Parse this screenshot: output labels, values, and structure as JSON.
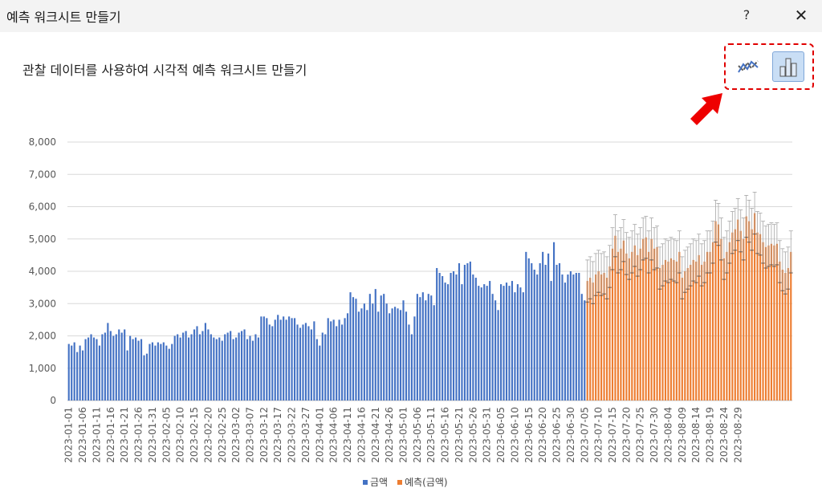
{
  "window": {
    "title": "예측 워크시트 만들기",
    "help_label": "?",
    "close_label": "✕"
  },
  "subtitle": "관찰 데이터를 사용하여 시각적 예측 워크시트 만들기",
  "chart_type_buttons": [
    {
      "name": "line-chart-icon",
      "selected": false
    },
    {
      "name": "column-chart-icon",
      "selected": true
    }
  ],
  "colors": {
    "actual": "#4472c4",
    "forecast": "#ed7d31",
    "gridline": "#d9d9d9",
    "error_bar": "#a6a6a6",
    "highlight": "#e00000"
  },
  "legend": {
    "actual_label": "금액",
    "forecast_label": "예측(금액)"
  },
  "chart_data": {
    "type": "bar",
    "ylim": [
      0,
      8000
    ],
    "y_ticks": [
      "0",
      "1,000",
      "2,000",
      "3,000",
      "4,000",
      "5,000",
      "6,000",
      "7,000",
      "8,000"
    ],
    "x_tick_labels": [
      "2023-01-01",
      "2023-01-06",
      "2023-01-11",
      "2023-01-16",
      "2023-01-21",
      "2023-01-26",
      "2023-01-31",
      "2023-02-05",
      "2023-02-10",
      "2023-02-15",
      "2023-02-20",
      "2023-02-25",
      "2023-03-02",
      "2023-03-07",
      "2023-03-12",
      "2023-03-17",
      "2023-03-22",
      "2023-03-27",
      "2023-04-01",
      "2023-04-06",
      "2023-04-11",
      "2023-04-16",
      "2023-04-21",
      "2023-04-26",
      "2023-05-01",
      "2023-05-06",
      "2023-05-11",
      "2023-05-16",
      "2023-05-21",
      "2023-05-26",
      "2023-05-31",
      "2023-06-05",
      "2023-06-10",
      "2023-06-15",
      "2023-06-20",
      "2023-06-25",
      "2023-06-30",
      "2023-07-05",
      "2023-07-10",
      "2023-07-15",
      "2023-07-20",
      "2023-07-25",
      "2023-07-30",
      "2023-08-04",
      "2023-08-09",
      "2023-08-14",
      "2023-08-19",
      "2023-08-24",
      "2023-08-29"
    ],
    "series": [
      {
        "name": "금액",
        "start": "2023-01-01",
        "values": [
          1750,
          1700,
          1800,
          1500,
          1700,
          1550,
          1900,
          1950,
          2050,
          1950,
          1900,
          1700,
          2050,
          2100,
          2400,
          2150,
          2000,
          2050,
          2200,
          2100,
          2200,
          1550,
          2000,
          1900,
          1950,
          1850,
          1900,
          1400,
          1450,
          1750,
          1800,
          1700,
          1800,
          1750,
          1800,
          1700,
          1600,
          1750,
          2000,
          2050,
          1950,
          2100,
          2150,
          1950,
          2050,
          2200,
          2300,
          2050,
          2150,
          2400,
          2200,
          2050,
          1950,
          1900,
          1950,
          1850,
          2050,
          2100,
          2150,
          1900,
          1950,
          2100,
          2150,
          2200,
          1900,
          2000,
          1850,
          2050,
          1950,
          2600,
          2600,
          2550,
          2350,
          2300,
          2500,
          2650,
          2500,
          2600,
          2500,
          2600,
          2550,
          2550,
          2350,
          2250,
          2350,
          2400,
          2300,
          2200,
          2450,
          1900,
          1700,
          2100,
          2050,
          2550,
          2450,
          2500,
          2300,
          2500,
          2350,
          2550,
          2700,
          3350,
          3200,
          3150,
          2750,
          2850,
          3000,
          2800,
          3300,
          3000,
          3450,
          2750,
          3250,
          3300,
          3000,
          2700,
          2850,
          2900,
          2850,
          2800,
          3100,
          2750,
          2350,
          2050,
          2600,
          3300,
          3200,
          3350,
          3100,
          3300,
          3250,
          2950,
          4100,
          3950,
          3850,
          3650,
          3600,
          3950,
          4000,
          3900,
          4250,
          3600,
          4200,
          4250,
          4300,
          3900,
          3800,
          3550,
          3500,
          3600,
          3550,
          3700,
          3300,
          3100,
          2800,
          3600,
          3550,
          3650,
          3550,
          3700,
          3350,
          3600,
          3500,
          3350,
          4600,
          4400,
          4250,
          4050,
          3900,
          4250,
          4600,
          4200,
          4550,
          3700,
          4900,
          4200,
          4250,
          3900,
          3650,
          3900,
          4000,
          3900,
          3950,
          3950,
          3300,
          3100
        ],
        "color": "#4472c4"
      },
      {
        "name": "예측(금액)",
        "start": "2023-07-01",
        "values": [
          3700,
          3800,
          3650,
          3900,
          4000,
          3900,
          3950,
          3800,
          4150,
          4700,
          5100,
          4600,
          4700,
          4950,
          4550,
          4400,
          4600,
          4800,
          4500,
          4700,
          5000,
          5050,
          4600,
          5000,
          4700,
          4750,
          4100,
          4200,
          4350,
          4300,
          4400,
          4350,
          4300,
          4600,
          3800,
          4000,
          4100,
          4200,
          4350,
          4300,
          4500,
          4200,
          4300,
          4600,
          4600,
          4900,
          5550,
          5450,
          5000,
          4400,
          4600,
          4900,
          5200,
          5300,
          5600,
          5250,
          5000,
          5700,
          5550,
          5300,
          5800,
          5200,
          5150,
          4900,
          4750,
          4800,
          4850,
          4800,
          4850,
          4300,
          4050,
          3950,
          4100,
          4600
        ],
        "color": "#ed7d31"
      }
    ],
    "error_bar_halfwidth": 650
  }
}
